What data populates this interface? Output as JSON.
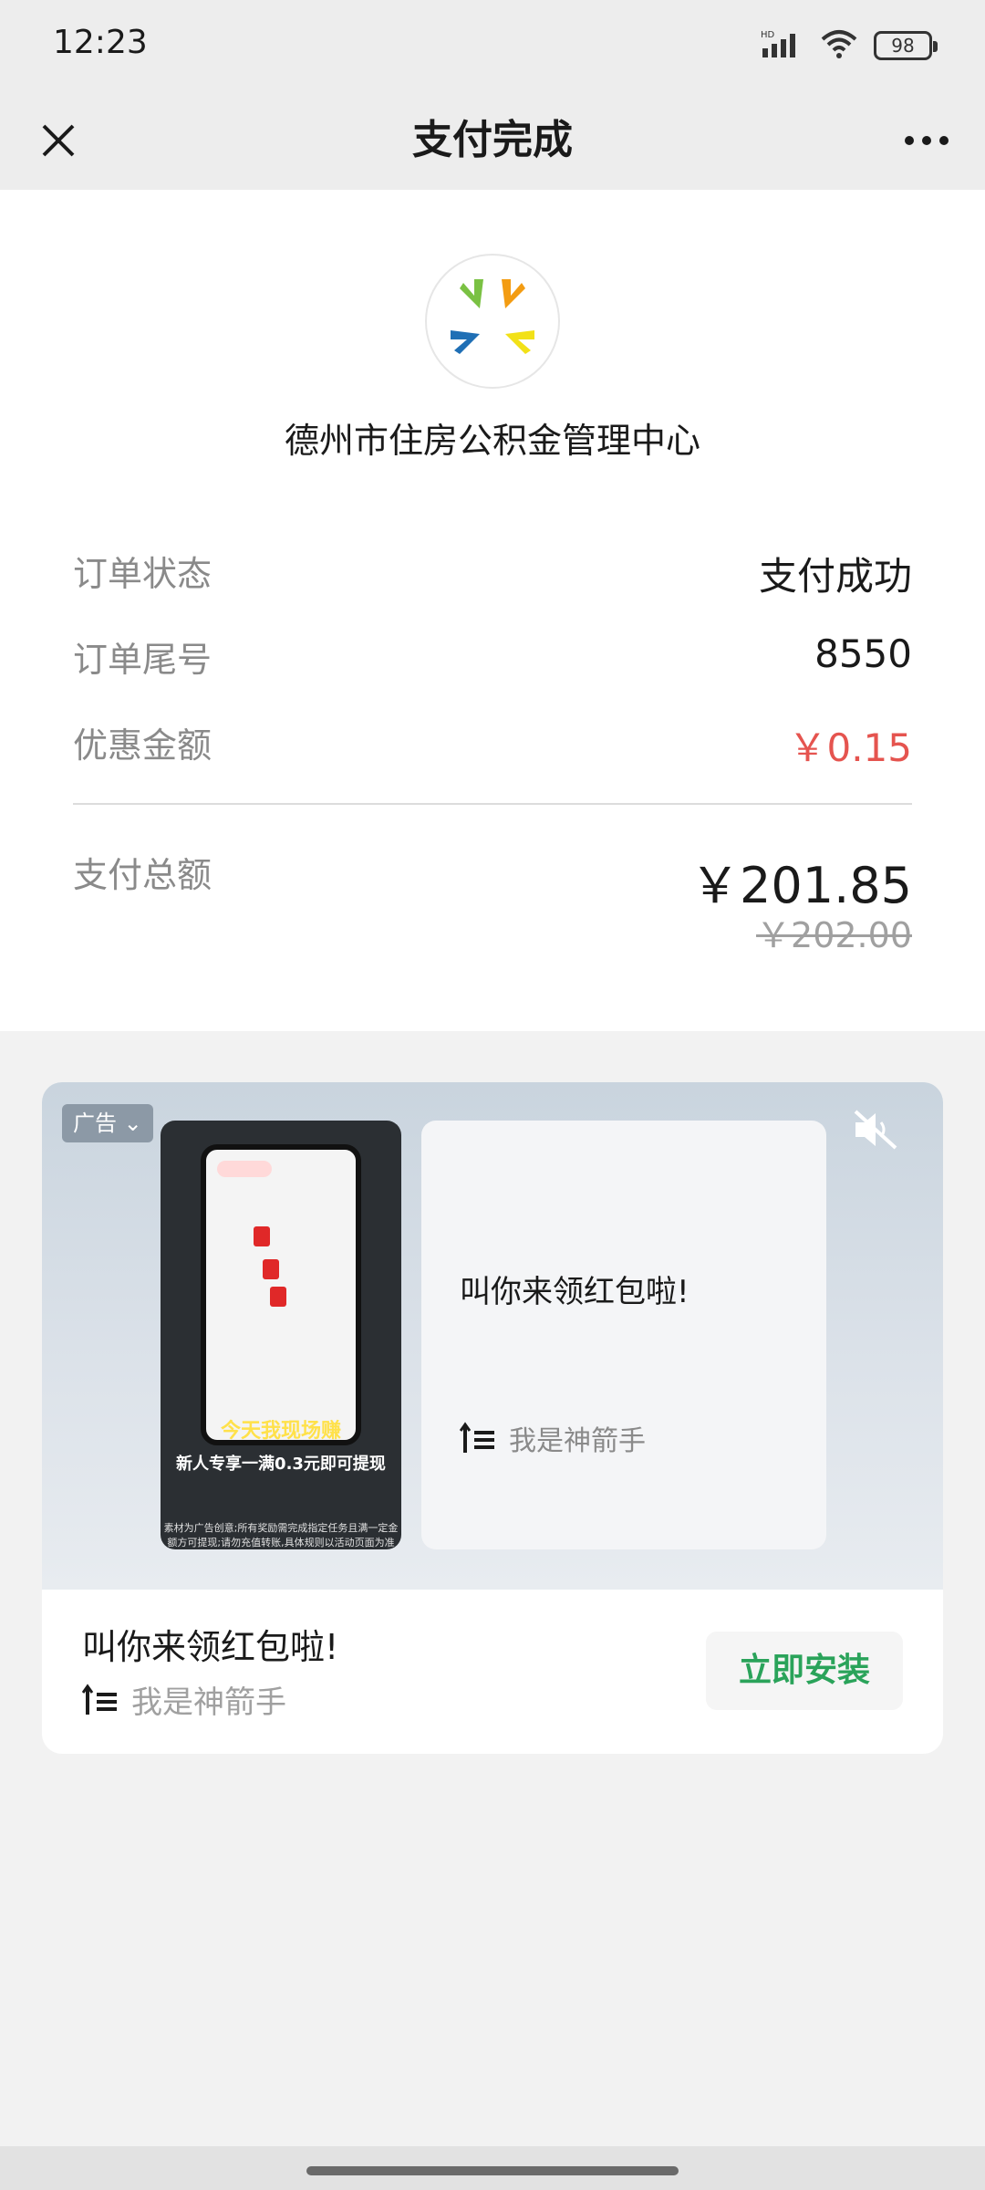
{
  "status_bar": {
    "time": "12:23",
    "battery": "98",
    "network_label": "HD"
  },
  "nav": {
    "title": "支付完成",
    "close_icon": "close-icon",
    "more_icon": "more-dots-icon"
  },
  "merchant": {
    "name": "德州市住房公积金管理中心",
    "logo_icon": "merchant-logo"
  },
  "order": {
    "status_label": "订单状态",
    "status_value": "支付成功",
    "tail_label": "订单尾号",
    "tail_value": "8550",
    "discount_label": "优惠金额",
    "discount_value": "￥0.15",
    "total_label": "支付总额",
    "total_value": "￥201.85",
    "original_value": "￥202.00"
  },
  "ad": {
    "tag": "广告",
    "title": "叫你来领红包啦!",
    "brand": "我是神箭手",
    "install_label": "立即安装",
    "video_caption_1": "今天我现场赚",
    "video_caption_2": "新人专享一满0.3元即可提现",
    "video_disclaimer": "素材为广告创意;所有奖励需完成指定任务且满一定金额方可提现;请勿充值转账,具体规则以活动页面为准"
  },
  "colors": {
    "accent_red": "#e5544f",
    "install_green": "#2aa35a"
  }
}
